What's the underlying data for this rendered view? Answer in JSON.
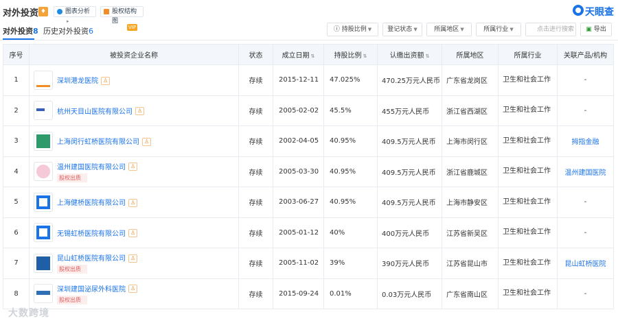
{
  "header": {
    "title": "对外投资",
    "alert_icon": "bell-icon",
    "chart_btn": "图表分析",
    "structure_btn": "股权结构图",
    "brand": "天眼查"
  },
  "tabs": {
    "current_label": "对外投资",
    "current_count": "8",
    "history_label": "历史对外投资",
    "history_count": "6",
    "vip": "VIP"
  },
  "filters": {
    "ratio": "持股比例",
    "status": "登记状态",
    "region": "所属地区",
    "industry": "所属行业",
    "search_placeholder": "点击进行搜索",
    "export": "导出"
  },
  "columns": [
    "序号",
    "被投资企业名称",
    "状态",
    "成立日期",
    "持股比例",
    "认缴出资额",
    "所属地区",
    "所属行业",
    "关联产品/机构"
  ],
  "rows": [
    {
      "idx": "1",
      "name": "深圳港龙医院",
      "status": "存续",
      "date": "2015-12-11",
      "pct": "47.025%",
      "capital": "470.25万元人民币",
      "region": "广东省龙岗区",
      "industry": "卫生和社会工作",
      "related": "-",
      "pledge": ""
    },
    {
      "idx": "2",
      "name": "杭州天目山医院有限公司",
      "status": "存续",
      "date": "2005-02-02",
      "pct": "45.5%",
      "capital": "455万元人民币",
      "region": "浙江省西湖区",
      "industry": "卫生和社会工作",
      "related": "-",
      "pledge": ""
    },
    {
      "idx": "3",
      "name": "上海闵行虹桥医院有限公司",
      "status": "存续",
      "date": "2002-04-05",
      "pct": "40.95%",
      "capital": "409.5万元人民币",
      "region": "上海市闵行区",
      "industry": "卫生和社会工作",
      "related": "拇指金融",
      "pledge": ""
    },
    {
      "idx": "4",
      "name": "温州建国医院有限公司",
      "status": "存续",
      "date": "2005-03-30",
      "pct": "40.95%",
      "capital": "409.5万元人民币",
      "region": "浙江省鹿城区",
      "industry": "卫生和社会工作",
      "related": "温州建国医院",
      "pledge": "股权出质"
    },
    {
      "idx": "5",
      "name": "上海健桥医院有限公司",
      "status": "存续",
      "date": "2003-06-27",
      "pct": "40.95%",
      "capital": "409.5万元人民币",
      "region": "上海市静安区",
      "industry": "卫生和社会工作",
      "related": "-",
      "pledge": ""
    },
    {
      "idx": "6",
      "name": "无锡虹桥医院有限公司",
      "status": "存续",
      "date": "2005-01-12",
      "pct": "40%",
      "capital": "400万元人民币",
      "region": "江苏省新吴区",
      "industry": "卫生和社会工作",
      "related": "-",
      "pledge": ""
    },
    {
      "idx": "7",
      "name": "昆山虹桥医院有限公司",
      "status": "存续",
      "date": "2005-11-02",
      "pct": "39%",
      "capital": "390万元人民币",
      "region": "江苏省昆山市",
      "industry": "卫生和社会工作",
      "related": "昆山虹桥医院",
      "pledge": "股权出质"
    },
    {
      "idx": "8",
      "name": "深圳建国泌尿外科医院",
      "status": "存续",
      "date": "2015-09-24",
      "pct": "0.01%",
      "capital": "0.03万元人民币",
      "region": "广东省南山区",
      "industry": "卫生和社会工作",
      "related": "-",
      "pledge": "股权出质"
    }
  ],
  "equity_tag": "♙",
  "watermark": "大数跨境",
  "colors": {
    "accent": "#1b73e8",
    "status_green": "#2e9a33",
    "pledge_red": "#e35b5b",
    "header_bg": "#f3f6fa"
  }
}
